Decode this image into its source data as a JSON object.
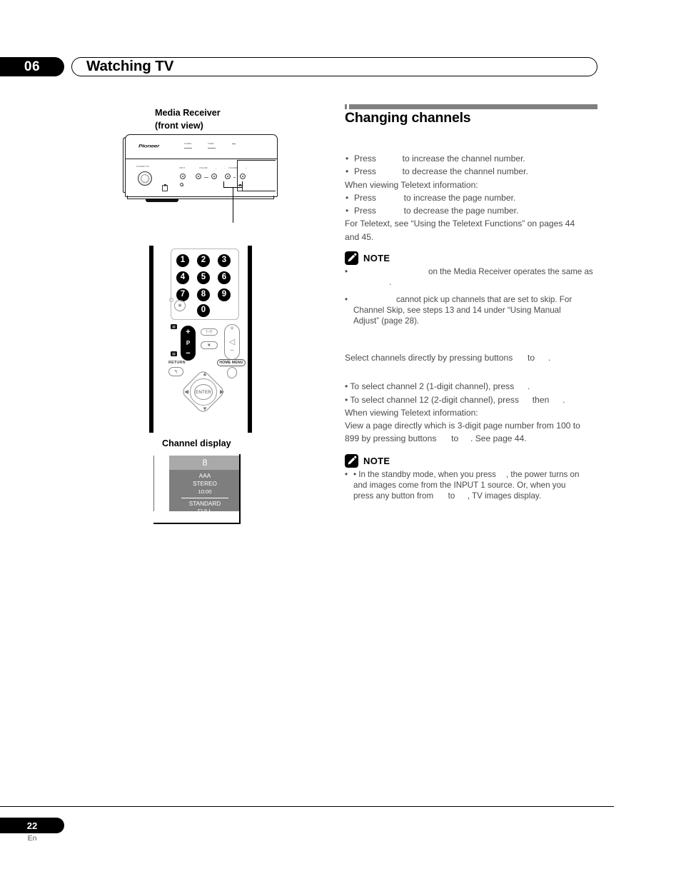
{
  "header": {
    "chapter_number": "06",
    "title": "Watching TV"
  },
  "left_column": {
    "media_receiver": {
      "caption_line1": "Media Receiver",
      "caption_line2": "(front view)",
      "brand_logo": "Pioneer",
      "standby_label": "STANDBY/ON",
      "labels": {
        "power": "POWER",
        "standby": "STANDBY",
        "timer": "TIMER",
        "input": "INPUT",
        "volume": "VOLUME",
        "channel": "CHANNEL",
        "minus": "−",
        "plus": "+"
      }
    },
    "remote": {
      "keys": [
        "1",
        "2",
        "3",
        "4",
        "5",
        "6",
        "7",
        "8",
        "9",
        "0"
      ],
      "teletext_key": "TXT",
      "channel_rocker": {
        "plus": "+",
        "label": "P",
        "minus": "−"
      },
      "volume_rocker": {
        "plus": "+",
        "icon": "◁",
        "minus": "−"
      },
      "dual_sound_button": "I–II",
      "mute_button": "MUTE",
      "return_label": "RETURN",
      "return_icon": "↰",
      "home_menu_label": "HOME MENU",
      "enter_button": "ENTER",
      "arrow_up": "▲",
      "arrow_down": "▼",
      "arrow_left": "◀",
      "arrow_right": "▶"
    },
    "channel_display": {
      "caption": "Channel display",
      "channel_number": "8",
      "station": "AAA",
      "sound_mode": "STEREO",
      "time": "10:00",
      "picture_mode": "STANDARD",
      "screen_size": "FULL",
      "colors": {
        "top_band": "#a9a9a9",
        "body": "#7e7e7e"
      }
    }
  },
  "right_column": {
    "section_title": "Changing channels",
    "intro_bullets": [
      {
        "pre": "• Press",
        "gap": true,
        "post": "to increase the channel number."
      },
      {
        "pre": "• Press",
        "gap": true,
        "post": "to decrease the channel number."
      }
    ],
    "teletext_intro": "When viewing Teletext information:",
    "teletext_bullets": [
      {
        "pre": "• Press",
        "gap": true,
        "post": "to increase the page number."
      },
      {
        "pre": "• Press",
        "gap": true,
        "post": "to decrease the page number."
      }
    ],
    "teletext_ref_line1": "For Teletext, see “Using the Teletext Functions” on pages 44",
    "teletext_ref_line2": "and 45.",
    "note1": {
      "label": "NOTE",
      "items": [
        {
          "line1_pre": "",
          "line1_post": "on the Media Receiver operates the same as",
          "line2": "."
        },
        {
          "line1_pre": "",
          "line1_post": "cannot pick up channels that are set to skip. For",
          "line2": "Channel Skip, see steps 13 and 14 under “Using Manual",
          "line3": "Adjust” (page 28)."
        }
      ]
    },
    "direct_select_line": {
      "pre": "Select channels directly by pressing buttons",
      "mid": "to",
      "post": "."
    },
    "example_bullets": [
      {
        "pre": "• To select channel 2 (1-digit channel), press",
        "post": "."
      },
      {
        "pre": "• To select channel 12 (2-digit channel), press",
        "mid": "then",
        "post": "."
      }
    ],
    "teletext_intro2": "When viewing Teletext information:",
    "teletext_page_line1": "View a page directly which is 3-digit page number from 100 to",
    "teletext_page_line2_pre": "899 by pressing buttons",
    "teletext_page_line2_mid": "to",
    "teletext_page_line2_post": ". See page 44.",
    "note2": {
      "label": "NOTE",
      "line1_pre": "• In the standby mode, when you press",
      "line1_post": ", the power turns on",
      "line2": "and images come from the INPUT 1 source. Or, when you",
      "line3_pre": "press any button from",
      "line3_mid": "to",
      "line3_post": ", TV images display."
    }
  },
  "footer": {
    "page_number": "22",
    "language": "En"
  }
}
